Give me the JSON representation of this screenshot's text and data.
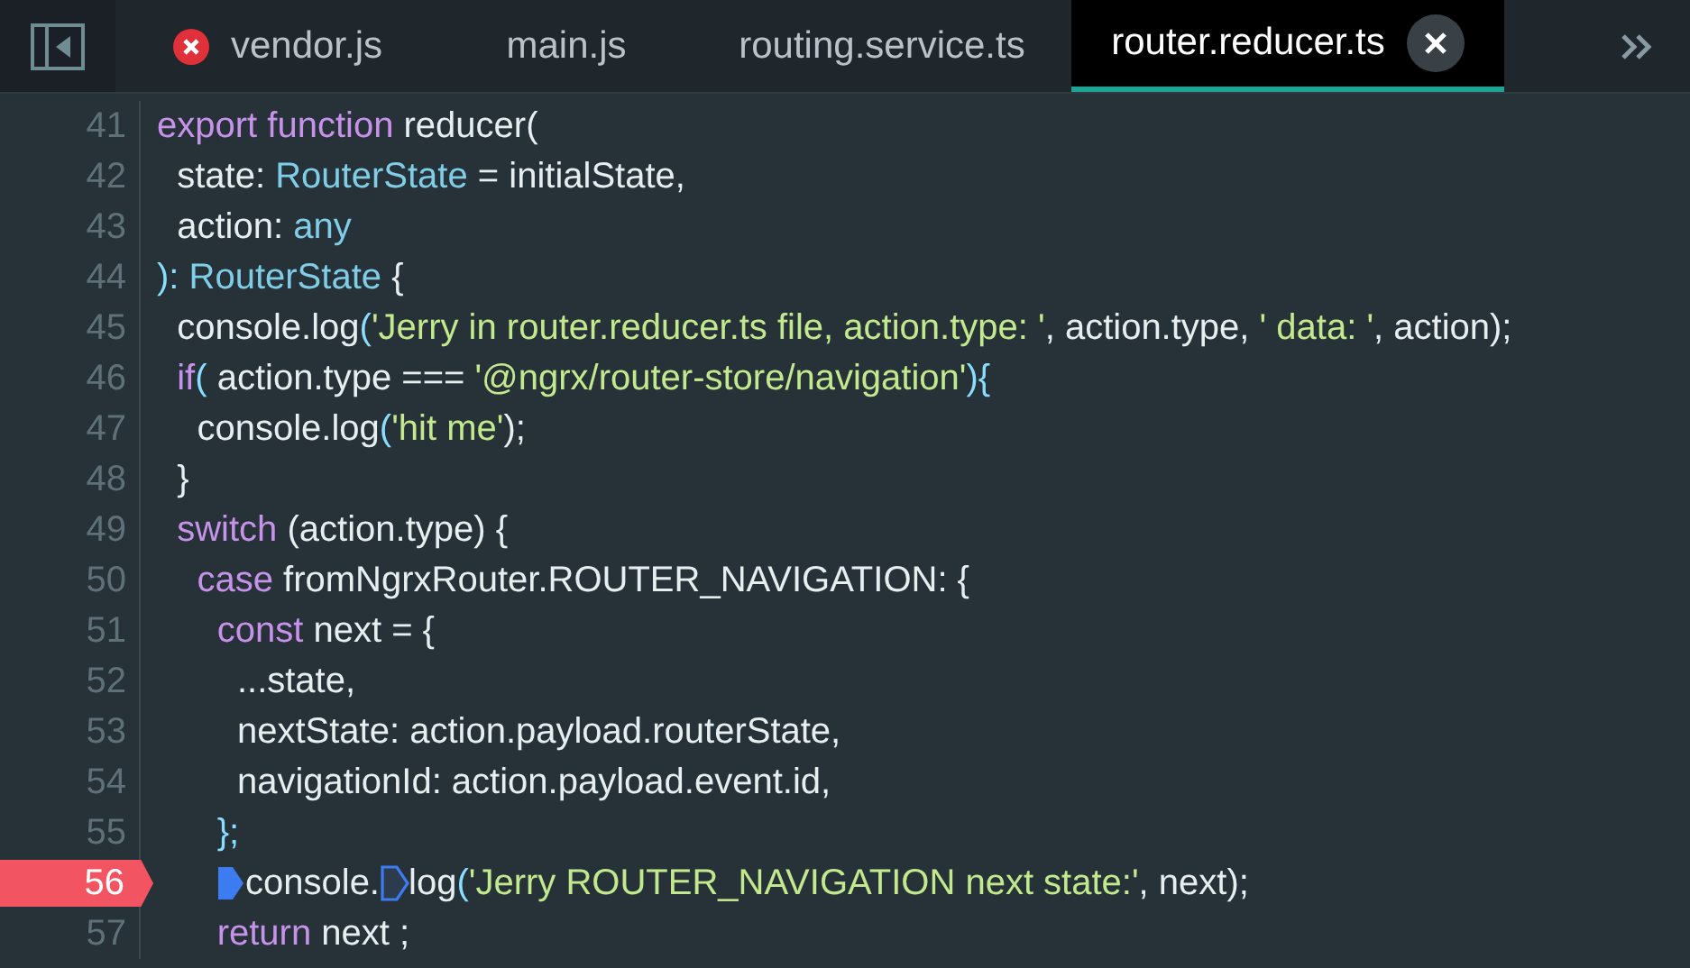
{
  "tabs": [
    {
      "label": "vendor.js",
      "selected": false,
      "error": true
    },
    {
      "label": "main.js",
      "selected": false,
      "error": false
    },
    {
      "label": "routing.service.ts",
      "selected": false,
      "error": false
    },
    {
      "label": "router.reducer.ts",
      "selected": true,
      "error": false
    }
  ],
  "lines": [
    {
      "number": "41",
      "breakpoint": false,
      "tokens": [
        {
          "kind": "keyword",
          "text": "export function"
        },
        {
          "kind": "plain",
          "text": " reducer("
        }
      ]
    },
    {
      "number": "42",
      "breakpoint": false,
      "tokens": [
        {
          "kind": "plain",
          "text": "  state: "
        },
        {
          "kind": "type",
          "text": "RouterState"
        },
        {
          "kind": "plain",
          "text": " = initialState,"
        }
      ]
    },
    {
      "number": "43",
      "breakpoint": false,
      "tokens": [
        {
          "kind": "plain",
          "text": "  action: "
        },
        {
          "kind": "type",
          "text": "any"
        }
      ]
    },
    {
      "number": "44",
      "breakpoint": false,
      "tokens": [
        {
          "kind": "punct",
          "text": "): "
        },
        {
          "kind": "type",
          "text": "RouterState"
        },
        {
          "kind": "plain",
          "text": " {"
        }
      ]
    },
    {
      "number": "45",
      "breakpoint": false,
      "tokens": [
        {
          "kind": "plain",
          "text": "  console.log"
        },
        {
          "kind": "punct",
          "text": "("
        },
        {
          "kind": "string",
          "text": "'Jerry in router.reducer.ts file, action.type: '"
        },
        {
          "kind": "plain",
          "text": ", action.type, "
        },
        {
          "kind": "string",
          "text": "' data: '"
        },
        {
          "kind": "plain",
          "text": ", action);"
        }
      ]
    },
    {
      "number": "46",
      "breakpoint": false,
      "tokens": [
        {
          "kind": "keyword",
          "text": "  if"
        },
        {
          "kind": "punct",
          "text": "("
        },
        {
          "kind": "plain",
          "text": " action.type === "
        },
        {
          "kind": "string",
          "text": "'@ngrx/router-store/navigation'"
        },
        {
          "kind": "punct",
          "text": "){"
        }
      ]
    },
    {
      "number": "47",
      "breakpoint": false,
      "tokens": [
        {
          "kind": "plain",
          "text": "    console.log"
        },
        {
          "kind": "punct",
          "text": "("
        },
        {
          "kind": "string",
          "text": "'hit me'"
        },
        {
          "kind": "plain",
          "text": ");"
        }
      ]
    },
    {
      "number": "48",
      "breakpoint": false,
      "tokens": [
        {
          "kind": "plain",
          "text": "  }"
        }
      ]
    },
    {
      "number": "49",
      "breakpoint": false,
      "tokens": [
        {
          "kind": "keyword",
          "text": "  switch"
        },
        {
          "kind": "plain",
          "text": " (action.type) {"
        }
      ]
    },
    {
      "number": "50",
      "breakpoint": false,
      "tokens": [
        {
          "kind": "keyword",
          "text": "    case"
        },
        {
          "kind": "plain",
          "text": " fromNgrxRouter.ROUTER_NAVIGATION: {"
        }
      ]
    },
    {
      "number": "51",
      "breakpoint": false,
      "tokens": [
        {
          "kind": "keyword",
          "text": "      const"
        },
        {
          "kind": "plain",
          "text": " next = {"
        }
      ]
    },
    {
      "number": "52",
      "breakpoint": false,
      "tokens": [
        {
          "kind": "plain",
          "text": "        ...state,"
        }
      ]
    },
    {
      "number": "53",
      "breakpoint": false,
      "tokens": [
        {
          "kind": "plain",
          "text": "        nextState: action.payload.routerState,"
        }
      ]
    },
    {
      "number": "54",
      "breakpoint": false,
      "tokens": [
        {
          "kind": "plain",
          "text": "        navigationId: action.payload.event.id,"
        }
      ]
    },
    {
      "number": "55",
      "breakpoint": false,
      "tokens": [
        {
          "kind": "punct",
          "text": "      };"
        }
      ]
    },
    {
      "number": "56",
      "breakpoint": true,
      "tokens": [
        {
          "kind": "bpfilled"
        },
        {
          "kind": "plain",
          "text": "console."
        },
        {
          "kind": "bpoutline"
        },
        {
          "kind": "plain",
          "text": "log"
        },
        {
          "kind": "punct",
          "text": "("
        },
        {
          "kind": "string",
          "text": "'Jerry ROUTER_NAVIGATION next state:'"
        },
        {
          "kind": "plain",
          "text": ", next);"
        }
      ]
    },
    {
      "number": "57",
      "breakpoint": false,
      "tokens": [
        {
          "kind": "keyword",
          "text": "      return"
        },
        {
          "kind": "plain",
          "text": " next ;"
        }
      ]
    }
  ]
}
